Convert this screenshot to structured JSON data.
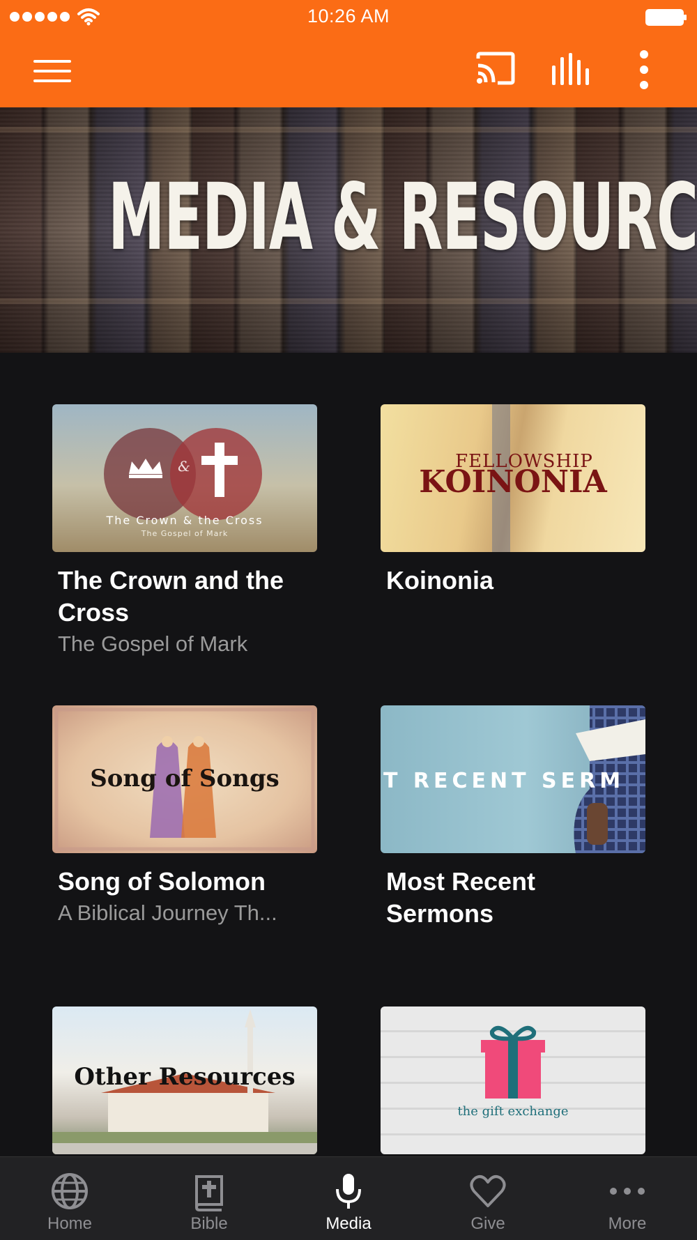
{
  "status_bar": {
    "time": "10:26 AM"
  },
  "colors": {
    "brand": "#fb6c15",
    "background": "#131315",
    "tab_bar": "#222224"
  },
  "header": {
    "menu_icon": "hamburger-menu-icon",
    "cast_icon": "cast-icon",
    "audio_icon": "audio-bars-icon",
    "more_icon": "more-vertical-icon"
  },
  "hero": {
    "title": "MEDIA & RESOURCES"
  },
  "cards": [
    {
      "title": "The Crown and the Cross",
      "subtitle": "The Gospel of Mark",
      "thumb": {
        "line1": "The Crown & the Cross",
        "line2": "The Gospel of Mark",
        "amp": "&"
      }
    },
    {
      "title": "Koinonia",
      "subtitle": "",
      "thumb": {
        "line1": "FELLOWSHIP",
        "line2": "KOINONIA"
      }
    },
    {
      "title": "Song of Solomon",
      "subtitle": "A Biblical Journey Th...",
      "thumb": {
        "line1": "Song of Songs"
      }
    },
    {
      "title": "Most Recent Sermons",
      "subtitle": "",
      "thumb": {
        "line1": "T RECENT SERM"
      }
    },
    {
      "title": "",
      "subtitle": "",
      "thumb": {
        "line1": "Other Resources"
      }
    },
    {
      "title": "",
      "subtitle": "",
      "thumb": {
        "line1": "the gift exchange"
      }
    }
  ],
  "tabs": [
    {
      "label": "Home",
      "icon": "globe-icon",
      "active": false
    },
    {
      "label": "Bible",
      "icon": "bible-icon",
      "active": false
    },
    {
      "label": "Media",
      "icon": "microphone-icon",
      "active": true
    },
    {
      "label": "Give",
      "icon": "heart-icon",
      "active": false
    },
    {
      "label": "More",
      "icon": "more-horizontal-icon",
      "active": false
    }
  ]
}
